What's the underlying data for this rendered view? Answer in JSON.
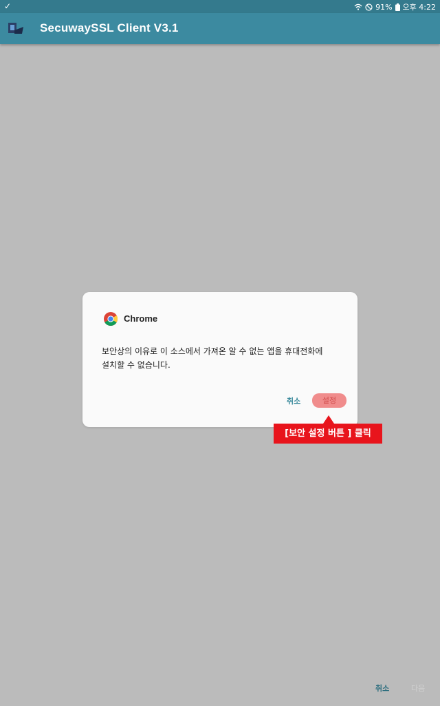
{
  "status_bar": {
    "battery_percent": "91%",
    "time": "오후 4:22",
    "icons": [
      "check-icon",
      "wifi-icon",
      "do-not-disturb-icon",
      "battery-icon"
    ]
  },
  "app_bar": {
    "title": "SecuwaySSL Client V3.1",
    "logo_icon": "app-logo-icon"
  },
  "dialog": {
    "app_name": "Chrome",
    "app_icon": "chrome-icon",
    "message_line1": "보안상의 이유로 이 소스에서 가져온 알 수 없는 앱을 휴대전화에",
    "message_line2": "설치할 수 없습니다.",
    "cancel_label": "취소",
    "settings_label": "설정"
  },
  "annotation": {
    "text": "[보안 설정 버튼 ] 클릭",
    "color": "#e8141c"
  },
  "footer": {
    "cancel_label": "취소",
    "next_label": "다음"
  },
  "colors": {
    "status_bar": "#347a8d",
    "app_bar": "#3c8aa0",
    "scrim": "#bbbbbb",
    "accent": "#3a8a9c",
    "highlight": "#f08c8c"
  }
}
